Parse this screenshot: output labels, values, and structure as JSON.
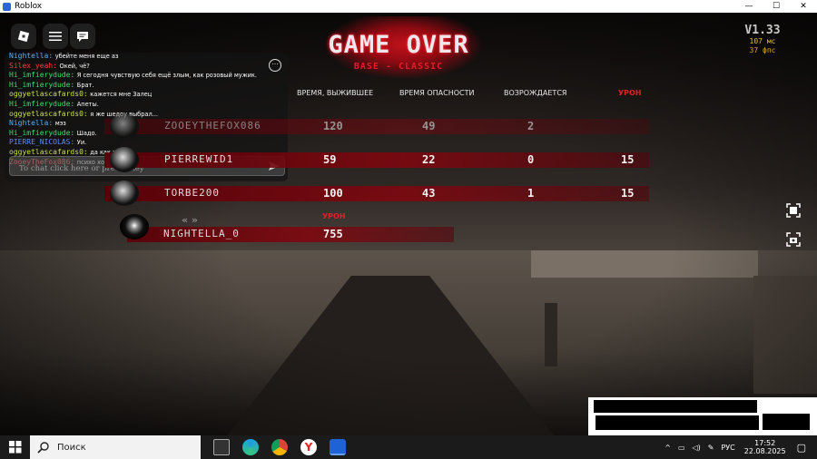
{
  "window": {
    "title": "Roblox",
    "controls": [
      "—",
      "☐",
      "✕"
    ]
  },
  "colors": {
    "accent_red": "#c1121b",
    "ping_yellow": "#e0c020",
    "fps_orange": "#e0a020"
  },
  "chat": {
    "lines": [
      {
        "user": "Nightella:",
        "color": "#4fb0ff",
        "msg": "убейте меня еще аз"
      },
      {
        "user": "Silex_yeah:",
        "color": "#ff3b3b",
        "msg": "Окей, чё?"
      },
      {
        "user": "Hi_imfierydude:",
        "color": "#39e06a",
        "msg": "Я сегодня чувствую себя ещё злым, как розовый мужик."
      },
      {
        "user": "Hi_imfierydude:",
        "color": "#39e06a",
        "msg": "Брат."
      },
      {
        "user": "oggyetlascafards0:",
        "color": "#c8e04a",
        "msg": "кажется мне Залец"
      },
      {
        "user": "Hi_imfierydude:",
        "color": "#39e06a",
        "msg": "Апеты."
      },
      {
        "user": "oggyetlascafards0:",
        "color": "#c8e04a",
        "msg": "я же шедоу выбрал..."
      },
      {
        "user": "Nightella:",
        "color": "#4fb0ff",
        "msg": "мэз"
      },
      {
        "user": "Hi_imfierydude:",
        "color": "#39e06a",
        "msg": "Шадо."
      },
      {
        "user": "PIERRE_NICOLAS:",
        "color": "#5a8cff",
        "msg": "Уи."
      },
      {
        "user": "oggyetlascafards0:",
        "color": "#c8e04a",
        "msg": "да как так то"
      },
      {
        "user": "ZooeyTheFox086:",
        "color": "#ff6a6a",
        "msg": "психо хоррор"
      }
    ],
    "placeholder": "To chat click here or press . key",
    "more_icon": "more-icon",
    "send_icon": "send-icon"
  },
  "logo": {
    "title": "GAME OVER",
    "subtitle": "BASE - CLASSIC"
  },
  "version": {
    "label": "V1.33",
    "ping": "107 мс",
    "fps": "37 фпс"
  },
  "headers": {
    "survived": "ВРЕМЯ, ВЫЖИВШЕЕ",
    "danger": "ВРЕМЯ ОПАСНОСТИ",
    "respawns": "ВОЗРОЖДАЕТСЯ",
    "damage": "УРОН",
    "damage2": "УРОН"
  },
  "players": [
    {
      "name": "ZOOEYTHEFOX086",
      "survived": "120",
      "danger": "49",
      "respawns": "2",
      "damage": ""
    },
    {
      "name": "PIERREWID1",
      "survived": "59",
      "danger": "22",
      "respawns": "0",
      "damage": "15"
    },
    {
      "name": "TORBE200",
      "survived": "100",
      "danger": "43",
      "respawns": "1",
      "damage": "15"
    }
  ],
  "killer": {
    "name": "NIGHTELLA_0",
    "damage": "755",
    "nav": "« »"
  },
  "taskbar": {
    "search_placeholder": "Поиск",
    "lang": "РУС",
    "time": "17:52",
    "date": "22.08.2025"
  }
}
